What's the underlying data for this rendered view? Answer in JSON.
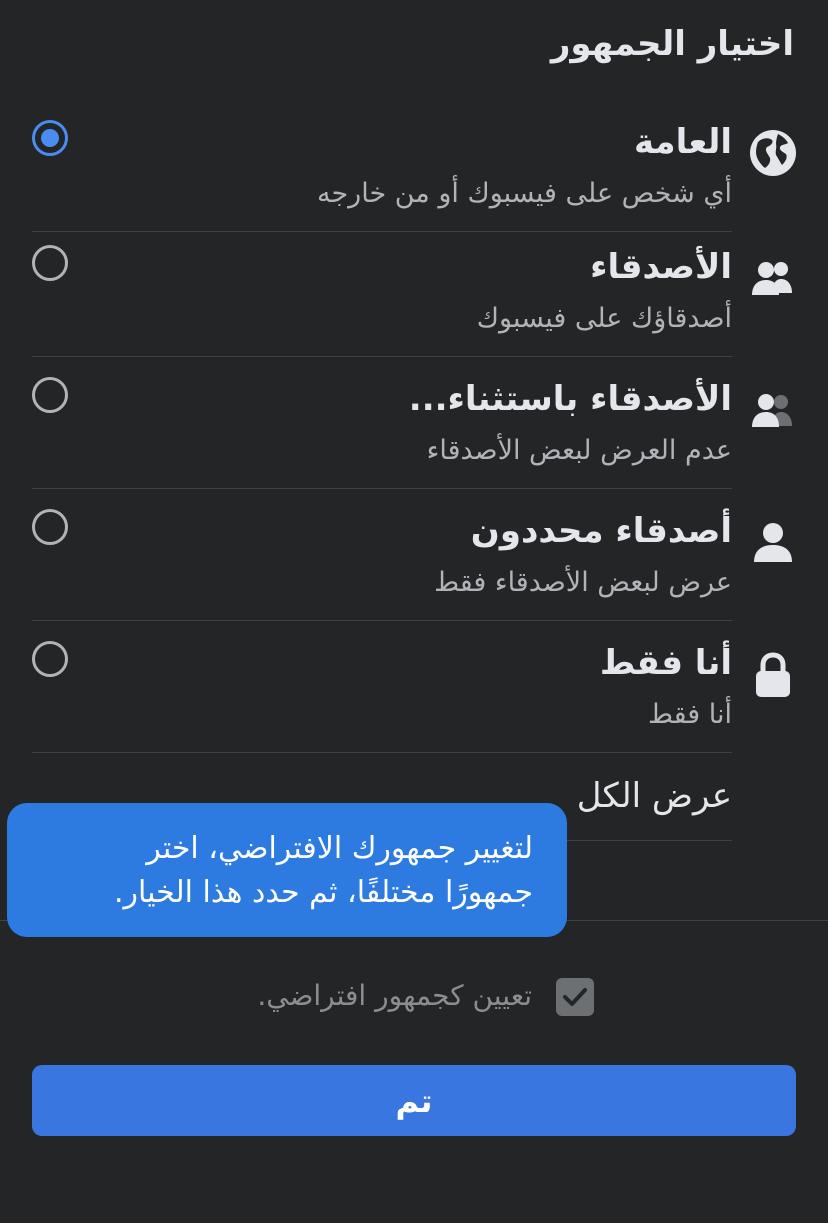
{
  "header": {
    "title": "اختيار الجمهور"
  },
  "options": [
    {
      "title": "العامة",
      "subtitle": "أي شخص على فيسبوك أو من خارجه",
      "icon": "globe-icon",
      "selected": true
    },
    {
      "title": "الأصدقاء",
      "subtitle": "أصدقاؤك على فيسبوك",
      "icon": "friends-icon",
      "selected": false
    },
    {
      "title": "الأصدقاء باستثناء...",
      "subtitle": "عدم العرض لبعض الأصدقاء",
      "icon": "friends-except-icon",
      "selected": false
    },
    {
      "title": "أصدقاء محددون",
      "subtitle": "عرض لبعض الأصدقاء فقط",
      "icon": "person-icon",
      "selected": false
    },
    {
      "title": "أنا فقط",
      "subtitle": "أنا فقط",
      "icon": "lock-icon",
      "selected": false
    }
  ],
  "see_all": {
    "label": "عرض الكل"
  },
  "tooltip": {
    "line1": "لتغيير جمهورك الافتراضي، اختر",
    "line2": "جمهورًا مختلفًا، ثم حدد هذا الخيار."
  },
  "default_checkbox": {
    "label": "تعيين كجمهور افتراضي.",
    "checked": true
  },
  "done_button": {
    "label": "تم"
  },
  "colors": {
    "background": "#242526",
    "accent": "#3a76e0",
    "radio_selected": "#4a8cf0",
    "tooltip": "#2d7be0"
  }
}
